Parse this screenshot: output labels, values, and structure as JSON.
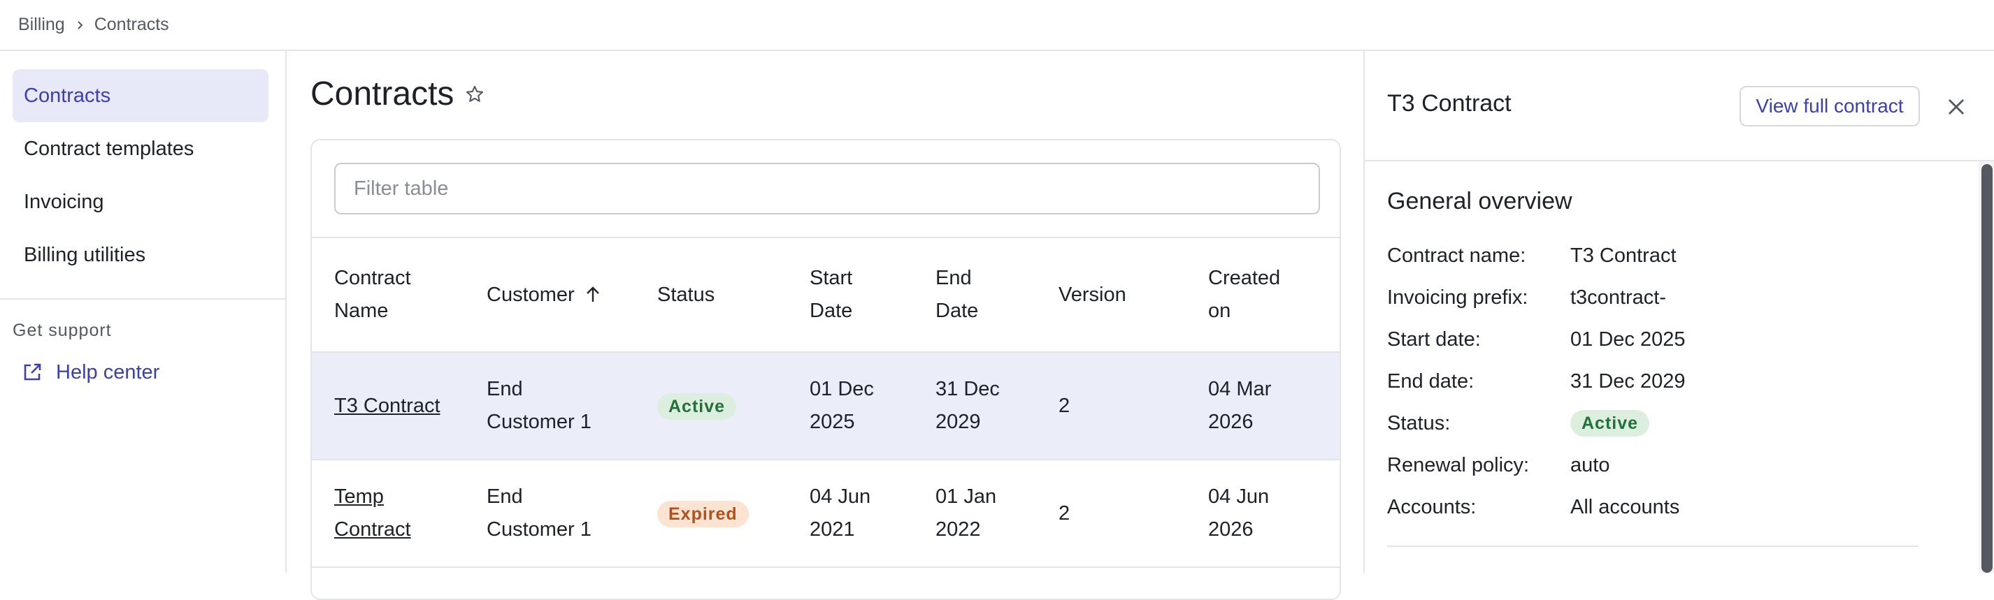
{
  "breadcrumb": {
    "items": [
      "Billing",
      "Contracts"
    ]
  },
  "sidebar": {
    "items": [
      {
        "label": "Contracts",
        "active": true
      },
      {
        "label": "Contract templates"
      },
      {
        "label": "Invoicing"
      },
      {
        "label": "Billing utilities"
      }
    ],
    "support_heading": "Get support",
    "help_link": "Help center"
  },
  "main": {
    "title": "Contracts",
    "filter_placeholder": "Filter table",
    "columns": {
      "name": [
        "Contract",
        "Name"
      ],
      "customer": "Customer",
      "status": "Status",
      "start": [
        "Start",
        "Date"
      ],
      "end": [
        "End",
        "Date"
      ],
      "version": "Version",
      "created": [
        "Created",
        "on"
      ]
    },
    "sort": {
      "column": "customer",
      "direction": "ascending"
    },
    "rows": [
      {
        "name": "T3 Contract",
        "customer": [
          "End",
          "Customer 1"
        ],
        "status": "Active",
        "start": [
          "01 Dec",
          "2025"
        ],
        "end": [
          "31 Dec",
          "2029"
        ],
        "version": "2",
        "created": [
          "04 Mar",
          "2026"
        ]
      },
      {
        "name": [
          "Temp",
          "Contract"
        ],
        "customer": [
          "End",
          "Customer 1"
        ],
        "status": "Expired",
        "start": [
          "04 Jun",
          "2021"
        ],
        "end": [
          "01 Jan",
          "2022"
        ],
        "version": "2",
        "created": [
          "04 Jun",
          "2026"
        ]
      }
    ]
  },
  "panel": {
    "title": "T3 Contract",
    "view_button": "View full contract",
    "section_title": "General overview",
    "fields": [
      {
        "key": "Contract name:",
        "value": "T3 Contract"
      },
      {
        "key": "Invoicing prefix:",
        "value": "t3contract-"
      },
      {
        "key": "Start date:",
        "value": "01 Dec 2025"
      },
      {
        "key": "End date:",
        "value": "31 Dec 2029"
      },
      {
        "key": "Status:",
        "value": "Active"
      },
      {
        "key": "Renewal policy:",
        "value": "auto"
      },
      {
        "key": "Accounts:",
        "value": "All accounts"
      }
    ]
  },
  "colors": {
    "accent": "#3b3fb0",
    "selected_nav_bg": "#e7e9f8",
    "selected_row_bg": "#ebedf8",
    "active_badge_bg": "#dcefdf",
    "active_badge_fg": "#22713a",
    "expired_badge_bg": "#fde3d2",
    "expired_badge_fg": "#b1521c"
  },
  "icons": [
    "chevron-right-icon",
    "external-link-icon",
    "star-outline-icon",
    "arrow-up-icon",
    "close-icon"
  ]
}
